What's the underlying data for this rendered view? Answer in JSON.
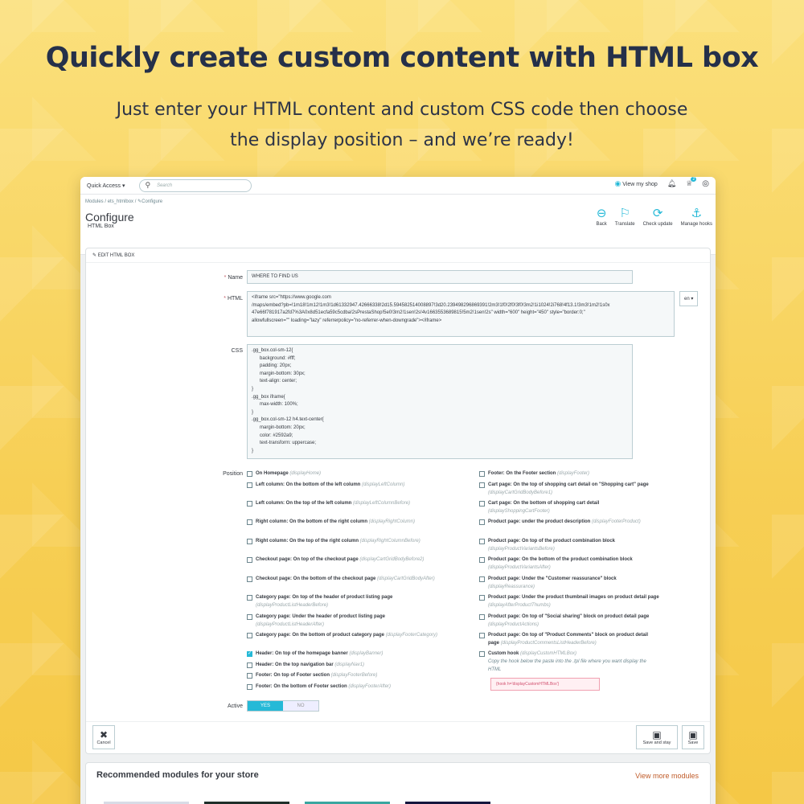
{
  "headline": "Quickly create custom content with HTML box",
  "subline_1": "Just enter your HTML content and custom CSS code then choose",
  "subline_2": "the display position – and we’re ready!",
  "topbar": {
    "quick_access": "Quick Access ▾",
    "search_placeholder": "Search",
    "view_shop": "View my shop",
    "notif_count": "2"
  },
  "breadcrumb": [
    "Modules",
    "ets_htmlbox",
    "Configure"
  ],
  "page": {
    "title": "Configure",
    "subtitle": "HTML Box"
  },
  "toolbar": [
    {
      "label": "Back",
      "icon": "back-icon"
    },
    {
      "label": "Translate",
      "icon": "flag-icon"
    },
    {
      "label": "Check update",
      "icon": "refresh-icon"
    },
    {
      "label": "Manage hooks",
      "icon": "anchor-icon"
    }
  ],
  "panel": {
    "heading": "EDIT HTML BOX",
    "name_label": "Name",
    "name_value": "WHERE TO FIND US",
    "html_label": "HTML",
    "html_value": "<iframe src=\"https://www.google.com\n/maps/embed?pb=!1m18!1m12!1m3!1d61332947.42666338!2d15.594582514008897!3d20.239498296869391!2m3!1f0!2f0!3f0!3m2!1i1024!2i768!4f13.1!3m3!1m2!1s0x\n47e66f781917a2fd7%3A0x8d51ecfa59c5cdba!2sPrestaShop!5e0!3m2!1sen!2s!4v1663553689815!5m2!1sen!2s\" width=\"600\" height=\"450\" style=\"border:0;\"\nallowfullscreen=\"\" loading=\"lazy\" referrerpolicy=\"no-referrer-when-downgrade\"></iframe>",
    "lang": "en ▾",
    "css_label": "CSS",
    "css_value": ".gg_box.col-sm-12{\n      background: #fff;\n      padding: 20px;\n      margin-bottom: 30px;\n      text-align: center;\n}\n.gg_box iframe{\n      max-width: 100%;\n}\n.gg_box.col-sm-12 h4.text-center{\n      margin-bottom: 20px;\n      color: #2592a9;\n      text-transform: uppercase;\n}",
    "position_label": "Position",
    "positions_left": [
      {
        "title": "On Homepage",
        "hook": "(displayHome)",
        "checked": false
      },
      {
        "title": "Left column: On the bottom of the left column",
        "hook": "(displayLeftColumn)",
        "checked": false
      },
      {
        "title": "Left column: On the top of the left column",
        "hook": "(displayLeftColumnBefore)",
        "checked": false
      },
      {
        "title": "Right column: On the bottom of the right column",
        "hook": "(displayRightColumn)",
        "checked": false
      },
      {
        "title": "Right column: On the top of the right column",
        "hook": "(displayRightColumnBefore)",
        "checked": false
      },
      {
        "title": "Checkout page: On top of the checkout page",
        "hook": "(displayCartGridBodyBefore2)",
        "checked": false
      },
      {
        "title": "Checkout page: On the bottom of the checkout page",
        "hook": "(displayCartGridBodyAfter)",
        "checked": false
      },
      {
        "title": "Category page: On top of the header of product listing page",
        "hook": "(displayProductListHeaderBefore)",
        "checked": false
      },
      {
        "title": "Category page: Under the header of product listing page",
        "hook": "(displayProductListHeaderAfter)",
        "checked": false
      },
      {
        "title": "Category page: On the bottom of product category page",
        "hook": "(displayFooterCategory)",
        "checked": false
      },
      {
        "title": "Header: On top of the homepage banner",
        "hook": "(displayBanner)",
        "checked": true
      },
      {
        "title": "Header: On the top navigation bar",
        "hook": "(displayNav1)",
        "checked": false
      },
      {
        "title": "Footer: On top of Footer section",
        "hook": "(displayFooterBefore)",
        "checked": false
      },
      {
        "title": "Footer: On the bottom of Footer section",
        "hook": "(displayFooterAfter)",
        "checked": false
      }
    ],
    "positions_right": [
      {
        "title": "Footer: On the Footer section",
        "hook": "(displayFooter)",
        "checked": false
      },
      {
        "title": "Cart page: On the top of shopping cart detail on \"Shopping cart\" page",
        "hook": "(displayCartGridBodyBefore1)",
        "checked": false
      },
      {
        "title": "Cart page: On the bottom of shopping cart detail",
        "hook": "(displayShoppingCartFooter)",
        "checked": false
      },
      {
        "title": "Product page: under the product description",
        "hook": "(displayFooterProduct)",
        "checked": false
      },
      {
        "title": "Product page: On top of the product combination block",
        "hook": "(displayProductVariantsBefore)",
        "checked": false
      },
      {
        "title": "Product page: On the bottom of the product combination block",
        "hook": "(displayProductVariantsAfter)",
        "checked": false
      },
      {
        "title": "Product page: Under the \"Customer reassurance\" block",
        "hook": "(displayReassurance)",
        "checked": false
      },
      {
        "title": "Product page: Under the product thumbnail images on product detail page",
        "hook": "(displayAfterProductThumbs)",
        "checked": false
      },
      {
        "title": "Product page: On top of \"Social sharing\" block on product detail page",
        "hook": "(displayProductActions)",
        "checked": false
      },
      {
        "title": "Product page: On top of \"Product Comments\" block on product detail page",
        "hook": "(displayProductCommentsListHeaderBefore)",
        "checked": false
      },
      {
        "title": "Custom hook",
        "hook": "(displayCustomHTMLBox)",
        "checked": false
      }
    ],
    "custom_hook_help": "Copy the hook below the paste into the .tpl file where you want display the HTML",
    "custom_hook_code": "{hook h='displayCustomHTMLBox'}",
    "active_label": "Active",
    "yes": "YES",
    "no": "NO",
    "cancel": "Cancel",
    "save_stay": "Save and stay",
    "save": "Save"
  },
  "recommended": {
    "title": "Recommended modules for your store",
    "link": "View more modules"
  },
  "colors": {
    "accent": "#25b9d7",
    "headline": "#25304a",
    "background": "#f8d25a"
  }
}
